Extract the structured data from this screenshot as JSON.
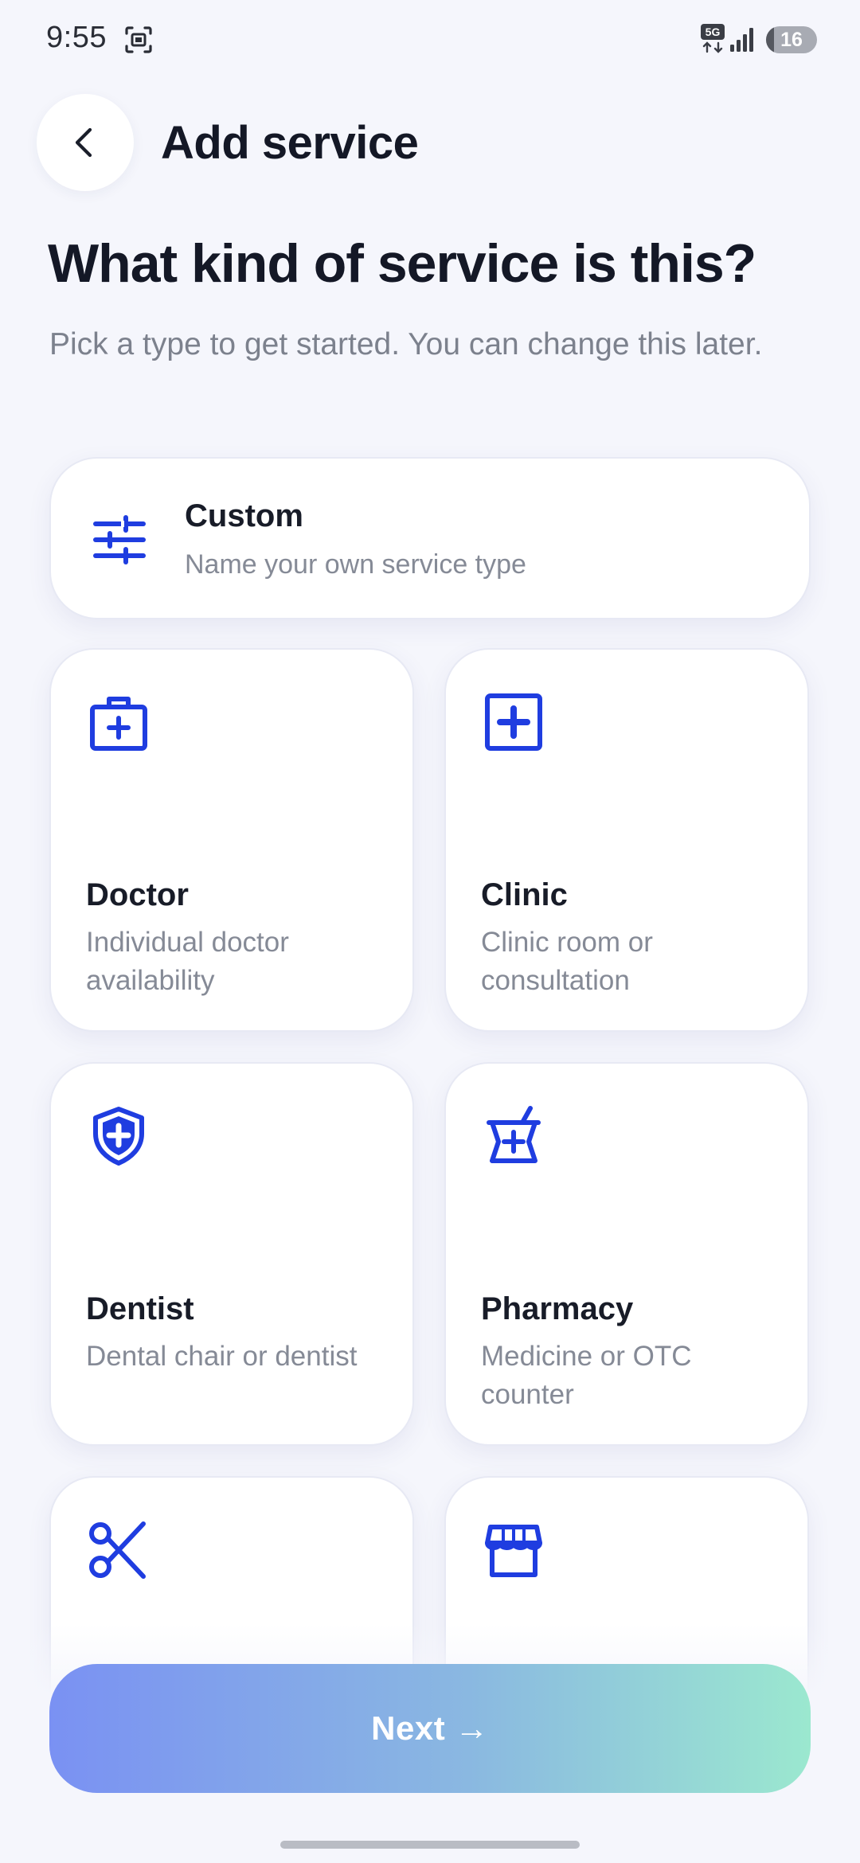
{
  "status_bar": {
    "time": "9:55",
    "network": "5G",
    "battery_level": "16",
    "battery_fraction": 0.16
  },
  "header": {
    "title": "Add service",
    "back_icon": "chevron-left-icon"
  },
  "intro": {
    "title": "What kind of service is this?",
    "subtitle": "Pick a type to get started. You can change this later."
  },
  "service_types": {
    "custom": {
      "title": "Custom",
      "description": "Name your own service type",
      "icon": "sliders-icon"
    },
    "doctor": {
      "title": "Doctor",
      "description": "Individual doctor availability",
      "icon": "medical-bag-icon"
    },
    "clinic": {
      "title": "Clinic",
      "description": "Clinic room or consultation",
      "icon": "medical-square-icon"
    },
    "dentist": {
      "title": "Dentist",
      "description": "Dental chair or dentist",
      "icon": "shield-plus-icon"
    },
    "pharmacy": {
      "title": "Pharmacy",
      "description": "Medicine or OTC counter",
      "icon": "mortar-pestle-icon"
    },
    "salon": {
      "icon": "scissors-icon"
    },
    "store": {
      "icon": "storefront-icon"
    }
  },
  "actions": {
    "next_label": "Next →"
  },
  "colors": {
    "accent": "#1f3de0",
    "background": "#f5f6fc",
    "next_gradient_start": "#7a91f3",
    "next_gradient_end": "#9be8cf"
  }
}
